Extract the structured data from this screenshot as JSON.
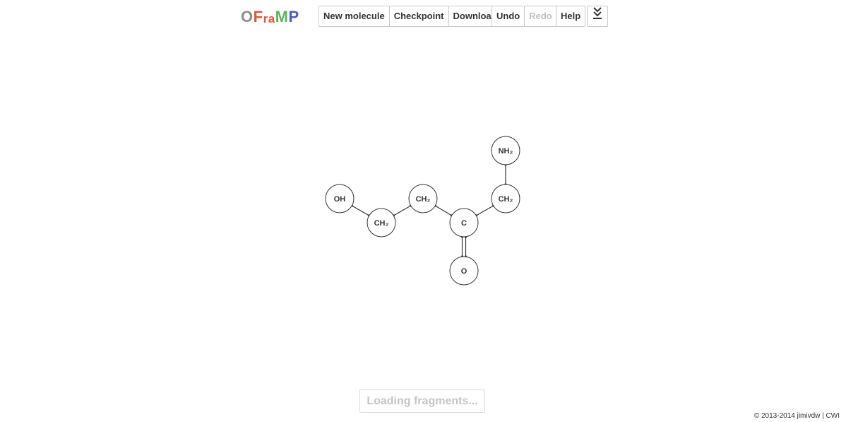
{
  "header": {
    "logo": {
      "letters": [
        "O",
        "F",
        "r",
        "a",
        "M",
        "P"
      ],
      "colors": [
        "#8c8c8c",
        "#d8583a",
        "#d8583a",
        "#d8583a",
        "#5bb55c",
        "#4a5bb8"
      ]
    },
    "toolbar": {
      "new_molecule_label": "New molecule",
      "checkpoint_label": "Checkpoint",
      "download_label": "Download",
      "undo_label": "Undo",
      "redo_label": "Redo",
      "help_label": "Help",
      "expand_icon": "double-chevron-down-icon"
    }
  },
  "molecule": {
    "atoms": [
      {
        "id": "a1",
        "label": "OH"
      },
      {
        "id": "a2",
        "label": "CH₂"
      },
      {
        "id": "a3",
        "label": "CH₂"
      },
      {
        "id": "a4",
        "label": "C"
      },
      {
        "id": "a5",
        "label": "O"
      },
      {
        "id": "a6",
        "label": "CH₂"
      },
      {
        "id": "a7",
        "label": "NH₂"
      }
    ],
    "bonds": [
      {
        "from": "a1",
        "to": "a2",
        "order": 1
      },
      {
        "from": "a2",
        "to": "a3",
        "order": 1
      },
      {
        "from": "a3",
        "to": "a4",
        "order": 1
      },
      {
        "from": "a4",
        "to": "a5",
        "order": 2
      },
      {
        "from": "a4",
        "to": "a6",
        "order": 1
      },
      {
        "from": "a6",
        "to": "a7",
        "order": 1
      }
    ]
  },
  "status": {
    "loading_text": "Loading fragments..."
  },
  "footer": {
    "copyright": "© 2013-2014",
    "author": "jimivdw",
    "separator": "|",
    "org": "CWI"
  }
}
